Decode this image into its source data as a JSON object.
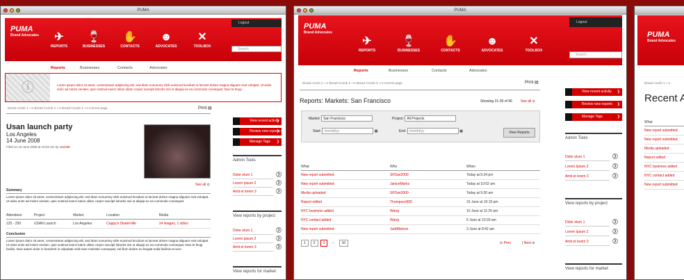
{
  "w1": {
    "title": "PUMA",
    "logo": "PUMA",
    "brand": "Brand Advocates",
    "nav": [
      "REPORTS",
      "BUSINESSES",
      "CONTACTS",
      "ADVOCATES",
      "TOOLBOX"
    ],
    "logout": "Logout",
    "search": "Search",
    "subnav": [
      "Reports",
      "Businesses",
      "Contacts",
      "Advocates"
    ],
    "alert": "Lorem ipsum dolor sit amet, consectetuer adipiscing elit, sed diam nonummy nibh euismod tincidunt ut lacreet dolore magna aliguam erat volutpat. Ut wisis enim ad minim veniam, quis nostrud exerci tution ullam corper suscipit lobortis nisi ut aliquip ex ea commodo consequat. Duis te feugi",
    "bc": [
      "Bread crumb 1",
      "Bread Crumb 2",
      "Bread Crumb 3",
      "Current page"
    ],
    "print": "Print",
    "event_title": "Usan launch party",
    "event_city": "Los Angeles",
    "event_date": "14 June 2008",
    "filed": "Filed on 16 June 2008 at 10:02 am by ",
    "filed_by": "Jane88",
    "see_all": "See all",
    "summary_h": "Summary",
    "summary": "Lorem ipsum dolor sit amet, consectetuer adipiscing elit, sed diam nonummy nibh euismod tincidunt ut lacreet dolore magna aliguam erat volutpat. Ut wisis enim ad minim veniam, quis nostrud exerci tution ullam corper suscipit lobortis nisi ut aliquip ex ea commodo consequat.",
    "cols": [
      "Attendees",
      "Project",
      "Market",
      "Location",
      "Media"
    ],
    "row": [
      "125 - 250",
      "USAN Launch",
      "Los Angeles",
      "Cappy's Shaterville",
      "14 images, 1 video"
    ],
    "conclusion_h": "Conclusion",
    "conclusion": "Lorem ipsum dolor sit amet, consectetuer adipiscing elit, sed diam nonummy nibh euismod tincidunt ut lacreet dolore magna aliguam erat volutpat. Ut wisis enim ad minim veniam, quis nostrud exerci tution ullam corper suscipit lobortis nisi ut aliquip ex ea commodo consequat. Duis te feugi facilisi. Duis autem dolor in hendrerit in vulputate velit esse molestie consequat, vel illum dolore eu feugiat nulla facilisis at vero",
    "actions": [
      "View recent activity",
      "Review new reports (5)",
      "Manage Tags"
    ],
    "admin_h": "Admin Tools",
    "admin_links": [
      "Dolor elum 1",
      "Lorem Ipsum 2",
      "Amit et lorem 3"
    ],
    "vrp_h": "View reports by project",
    "vrp_links": [
      "Dolor elum 1",
      "Lorem Ipsum 2",
      "Amit et lorem 3"
    ],
    "vrm_h": "View reports for market"
  },
  "w2": {
    "title": "PUMA",
    "logo": "PUMA",
    "brand": "Brand Advocates",
    "nav": [
      "REPORTS",
      "BUSINESSES",
      "CONTACTS",
      "ADVOCATES",
      "TOOLBOX"
    ],
    "logout": "Logout",
    "search": "Search",
    "subnav": [
      "Reports",
      "Businesses",
      "Contacts",
      "Advocates"
    ],
    "bc": [
      "Bread crumb 1",
      "Bread Crumb 2",
      "Bread Crumb 3",
      "Current page"
    ],
    "print": "Print",
    "heading": "Reports: Markets: San Francisco",
    "showing": "Showing 21-30 of 96",
    "see_all": "See all",
    "market_l": "Market:",
    "market_v": "San Francisco",
    "project_l": "Project:",
    "project_v": "All Projects",
    "start_l": "Start:",
    "start_v": "mm/dd/yy",
    "end_l": "End:",
    "end_v": "mm/dd/yy",
    "view_btn": "View Reports",
    "cols": [
      "What",
      "Who",
      "When"
    ],
    "rows": [
      [
        "New report submitted",
        "SFDan2000",
        "Today at 5:24 pm"
      ],
      [
        "New report submitted",
        "JaniceMarks",
        "Today at 10:02 am"
      ],
      [
        "Media uploaded",
        "SFDan2000",
        "Today at 9:30 am"
      ],
      [
        "Report edited",
        "Thompson555",
        "15 June at 10:15 pm"
      ],
      [
        "NYC business added",
        "Wang",
        "10 June at 11:20 am"
      ],
      [
        "NYC contact added",
        "Wang",
        "5 June at 10:30 am"
      ],
      [
        "New report submitted",
        "JuddNelson",
        "3 June at 8:42 am"
      ]
    ],
    "pages": [
      "1",
      "2",
      "3",
      "...",
      "10"
    ],
    "prev": "Prev",
    "next": "Next",
    "actions": [
      "View recent activity",
      "Review new reports",
      "Manage Tags"
    ],
    "admin_h": "Admin Tools",
    "admin_links": [
      "Dolor elum 1",
      "Lorem Ipsum 2",
      "Amit et lorem 3"
    ],
    "vrp_h": "View reports by project",
    "vrp_links": [
      "Dolor elum 1",
      "Lorem Ipsum 2",
      "Amit et lorem 3"
    ],
    "vrm_h": "View reports for market"
  },
  "w3": {
    "logo": "PUMA",
    "brand": "Brand Advocates",
    "bc": "Bread crumb 1",
    "heading": "Recent A",
    "col": "What",
    "rows": [
      "New report submitted",
      "New report submitted",
      "Media uploaded",
      "Report edited",
      "NYC business added",
      "NYC contact added",
      "New report submitted"
    ]
  },
  "colors": {
    "accent": "#d40000",
    "bg": "#8b0a0a"
  }
}
